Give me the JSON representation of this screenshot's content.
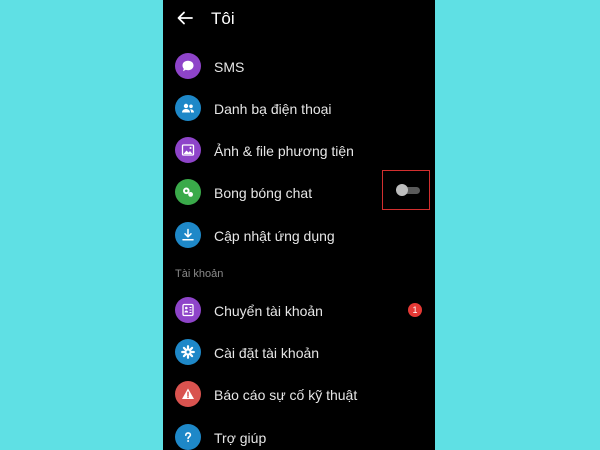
{
  "header": {
    "title": "Tôi"
  },
  "items": [
    {
      "label": "SMS",
      "icon": "sms-icon",
      "color": "#8e44c9"
    },
    {
      "label": "Danh bạ điện thoại",
      "icon": "contacts-icon",
      "color": "#1e88c8"
    },
    {
      "label": "Ảnh & file phương tiện",
      "icon": "photo-icon",
      "color": "#8e44c9"
    },
    {
      "label": "Bong bóng chat",
      "icon": "chat-bubble-icon",
      "color": "#3aaa4a",
      "toggle": false
    },
    {
      "label": "Cập nhật ứng dụng",
      "icon": "download-icon",
      "color": "#1e88c8"
    }
  ],
  "account_section": {
    "title": "Tài khoản",
    "items": [
      {
        "label": "Chuyển tài khoản",
        "icon": "switch-account-icon",
        "color": "#8e44c9",
        "badge": "1"
      },
      {
        "label": "Cài đặt tài khoản",
        "icon": "gear-icon",
        "color": "#1e88c8"
      },
      {
        "label": "Báo cáo sự cố kỹ thuật",
        "icon": "warning-icon",
        "color": "#d9534f"
      },
      {
        "label": "Trợ giúp",
        "icon": "help-icon",
        "color": "#1e88c8"
      }
    ]
  }
}
